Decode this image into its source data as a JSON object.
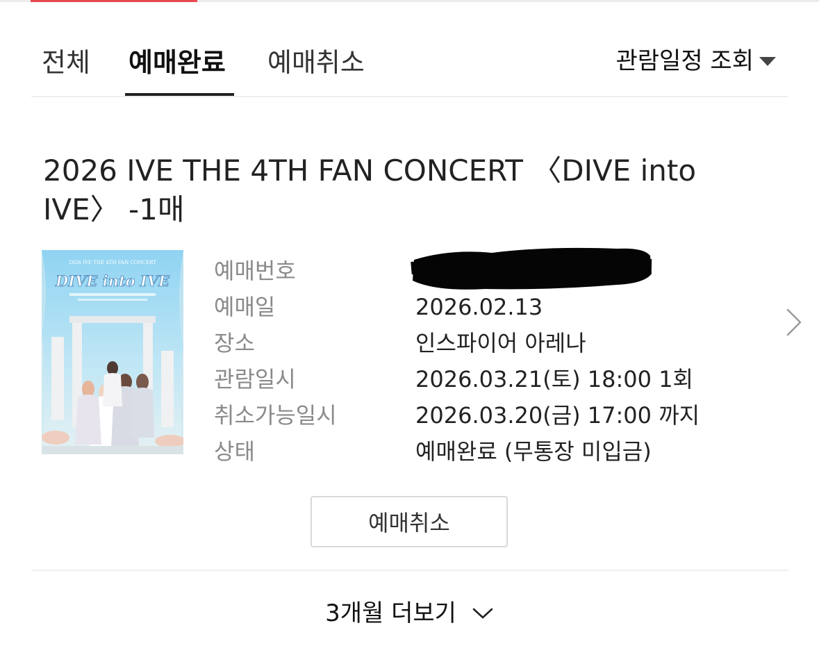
{
  "tabs": [
    {
      "label": "전체"
    },
    {
      "label": "예매완료"
    },
    {
      "label": "예매취소"
    }
  ],
  "schedule_filter": {
    "label": "관람일정 조회"
  },
  "booking": {
    "title": "2026 IVE THE 4TH FAN CONCERT 〈DIVE into IVE〉 -1매",
    "poster": {
      "header": "2026 IVE THE 4TH FAN CONCERT",
      "logo": "DIVE into IVE"
    },
    "details": [
      {
        "label": "예매번호",
        "value": ""
      },
      {
        "label": "예매일",
        "value": "2026.02.13"
      },
      {
        "label": "장소",
        "value": "인스파이어 아레나"
      },
      {
        "label": "관람일시",
        "value": "2026.03.21(토) 18:00 1회"
      },
      {
        "label": "취소가능일시",
        "value": "2026.03.20(금) 17:00 까지"
      },
      {
        "label": "상태",
        "value": "예매완료 (무통장 미입금)"
      }
    ],
    "cancel_button": "예매취소"
  },
  "more": {
    "label": "3개월 더보기"
  },
  "colors": {
    "accent": "#e5484d",
    "text": "#222222",
    "label": "#8a8a8a",
    "divider": "#eeeeee"
  },
  "icons": [
    "caret-down-icon",
    "chevron-right-icon",
    "chevron-down-icon"
  ]
}
